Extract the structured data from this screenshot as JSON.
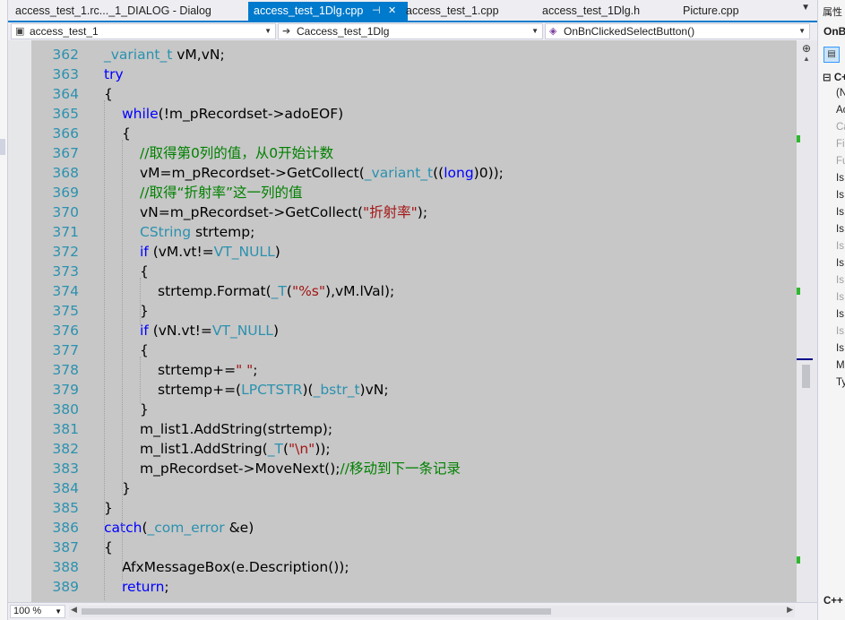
{
  "tabs": [
    {
      "label": "access_test_1.rc..._1_DIALOG - Dialog",
      "active": false
    },
    {
      "label": "access_test_1Dlg.cpp",
      "active": true
    },
    {
      "label": "access_test_1.cpp",
      "active": false
    },
    {
      "label": "access_test_1Dlg.h",
      "active": false
    },
    {
      "label": "Picture.cpp",
      "active": false
    }
  ],
  "tab_pin_glyph": "⊣",
  "tab_close_glyph": "✕",
  "tab_menu_glyph": "▼",
  "navbar": {
    "project": "access_test_1",
    "scope": "Caccess_test_1Dlg",
    "member": "OnBnClickedSelectButton()"
  },
  "editor": {
    "lines": [
      {
        "num": "362",
        "indent": 0,
        "tokens": [
          {
            "t": "_variant_t",
            "c": "ty"
          },
          {
            "t": " vM,vN;",
            "c": ""
          }
        ]
      },
      {
        "num": "363",
        "indent": 0,
        "tokens": [
          {
            "t": "try",
            "c": "kw"
          }
        ]
      },
      {
        "num": "364",
        "indent": 0,
        "tokens": [
          {
            "t": "{",
            "c": ""
          }
        ]
      },
      {
        "num": "365",
        "indent": 1,
        "tokens": [
          {
            "t": "while",
            "c": "kw"
          },
          {
            "t": "(!m_pRecordset->adoEOF)",
            "c": ""
          }
        ]
      },
      {
        "num": "366",
        "indent": 1,
        "tokens": [
          {
            "t": "{",
            "c": ""
          }
        ]
      },
      {
        "num": "367",
        "indent": 2,
        "tokens": [
          {
            "t": "//取得第0列的值，从0开始计数",
            "c": "cm"
          }
        ]
      },
      {
        "num": "368",
        "indent": 2,
        "tokens": [
          {
            "t": "vM=m_pRecordset->GetCollect(",
            "c": ""
          },
          {
            "t": "_variant_t",
            "c": "ty"
          },
          {
            "t": "((",
            "c": ""
          },
          {
            "t": "long",
            "c": "kw"
          },
          {
            "t": ")0));",
            "c": ""
          }
        ]
      },
      {
        "num": "369",
        "indent": 2,
        "tokens": [
          {
            "t": "//取得“折射率”这一列的值",
            "c": "cm"
          }
        ]
      },
      {
        "num": "370",
        "indent": 2,
        "tokens": [
          {
            "t": "vN=m_pRecordset->GetCollect(",
            "c": ""
          },
          {
            "t": "\"折射率\"",
            "c": "st"
          },
          {
            "t": ");",
            "c": ""
          }
        ]
      },
      {
        "num": "371",
        "indent": 2,
        "tokens": [
          {
            "t": "CString",
            "c": "ty"
          },
          {
            "t": " strtemp;",
            "c": ""
          }
        ]
      },
      {
        "num": "372",
        "indent": 2,
        "tokens": [
          {
            "t": "if",
            "c": "kw"
          },
          {
            "t": " (vM.vt!=",
            "c": ""
          },
          {
            "t": "VT_NULL",
            "c": "ty"
          },
          {
            "t": ")",
            "c": ""
          }
        ]
      },
      {
        "num": "373",
        "indent": 2,
        "tokens": [
          {
            "t": "{",
            "c": ""
          }
        ]
      },
      {
        "num": "374",
        "indent": 3,
        "tokens": [
          {
            "t": "strtemp.Format(",
            "c": ""
          },
          {
            "t": "_T",
            "c": "ty"
          },
          {
            "t": "(",
            "c": ""
          },
          {
            "t": "\"%s\"",
            "c": "st"
          },
          {
            "t": "),vM.lVal);",
            "c": ""
          }
        ]
      },
      {
        "num": "375",
        "indent": 2,
        "tokens": [
          {
            "t": "}",
            "c": ""
          }
        ]
      },
      {
        "num": "376",
        "indent": 2,
        "tokens": [
          {
            "t": "if",
            "c": "kw"
          },
          {
            "t": " (vN.vt!=",
            "c": ""
          },
          {
            "t": "VT_NULL",
            "c": "ty"
          },
          {
            "t": ")",
            "c": ""
          }
        ]
      },
      {
        "num": "377",
        "indent": 2,
        "tokens": [
          {
            "t": "{",
            "c": ""
          }
        ]
      },
      {
        "num": "378",
        "indent": 3,
        "tokens": [
          {
            "t": "strtemp+=",
            "c": ""
          },
          {
            "t": "\" \"",
            "c": "st"
          },
          {
            "t": ";",
            "c": ""
          }
        ]
      },
      {
        "num": "379",
        "indent": 3,
        "tokens": [
          {
            "t": "strtemp+=(",
            "c": ""
          },
          {
            "t": "LPCTSTR",
            "c": "ty"
          },
          {
            "t": ")(",
            "c": ""
          },
          {
            "t": "_bstr_t",
            "c": "ty"
          },
          {
            "t": ")vN;",
            "c": ""
          }
        ]
      },
      {
        "num": "380",
        "indent": 2,
        "tokens": [
          {
            "t": "}",
            "c": ""
          }
        ]
      },
      {
        "num": "381",
        "indent": 2,
        "tokens": [
          {
            "t": "m_list1.AddString(strtemp);",
            "c": ""
          }
        ]
      },
      {
        "num": "382",
        "indent": 2,
        "tokens": [
          {
            "t": "m_list1.AddString(",
            "c": ""
          },
          {
            "t": "_T",
            "c": "ty"
          },
          {
            "t": "(",
            "c": ""
          },
          {
            "t": "\"\\n\"",
            "c": "st"
          },
          {
            "t": "));",
            "c": ""
          }
        ]
      },
      {
        "num": "383",
        "indent": 2,
        "tokens": [
          {
            "t": "m_pRecordset->MoveNext();",
            "c": ""
          },
          {
            "t": "//移动到下一条记录",
            "c": "cm"
          }
        ]
      },
      {
        "num": "384",
        "indent": 1,
        "tokens": [
          {
            "t": "}",
            "c": ""
          }
        ]
      },
      {
        "num": "385",
        "indent": 0,
        "tokens": [
          {
            "t": "}",
            "c": ""
          }
        ]
      },
      {
        "num": "386",
        "indent": 0,
        "tokens": [
          {
            "t": "catch",
            "c": "kw"
          },
          {
            "t": "(",
            "c": ""
          },
          {
            "t": "_com_error",
            "c": "ty"
          },
          {
            "t": " &e)",
            "c": ""
          }
        ]
      },
      {
        "num": "387",
        "indent": 0,
        "tokens": [
          {
            "t": "{",
            "c": ""
          }
        ]
      },
      {
        "num": "388",
        "indent": 1,
        "tokens": [
          {
            "t": "AfxMessageBox(e.Description());",
            "c": ""
          }
        ]
      },
      {
        "num": "389",
        "indent": 1,
        "tokens": [
          {
            "t": "return",
            "c": "kw"
          },
          {
            "t": ";",
            "c": ""
          }
        ]
      }
    ],
    "colors": {
      "keyword": "#0000ff",
      "type": "#2b91af",
      "comment": "#008000",
      "string": "#a31515",
      "line_number": "#2b91af",
      "background": "#c7c7c7"
    }
  },
  "zoom": "100 %",
  "properties": {
    "title": "属性",
    "object": "OnB",
    "category": "C++",
    "rows": [
      {
        "label": "(N",
        "dim": false
      },
      {
        "label": "Ac",
        "dim": false
      },
      {
        "label": "Ca",
        "dim": true
      },
      {
        "label": "Fil",
        "dim": true
      },
      {
        "label": "Fu",
        "dim": true
      },
      {
        "label": "Is",
        "dim": false
      },
      {
        "label": "Is",
        "dim": false
      },
      {
        "label": "Is",
        "dim": false
      },
      {
        "label": "Is",
        "dim": false
      },
      {
        "label": "Is",
        "dim": true
      },
      {
        "label": "Is",
        "dim": false
      },
      {
        "label": "Is",
        "dim": true
      },
      {
        "label": "Is",
        "dim": true
      },
      {
        "label": "Is",
        "dim": false
      },
      {
        "label": "Is",
        "dim": true
      },
      {
        "label": "Is",
        "dim": false
      },
      {
        "label": "M",
        "dim": false
      },
      {
        "label": "Ty",
        "dim": false
      }
    ],
    "bottom_label": "C++"
  }
}
